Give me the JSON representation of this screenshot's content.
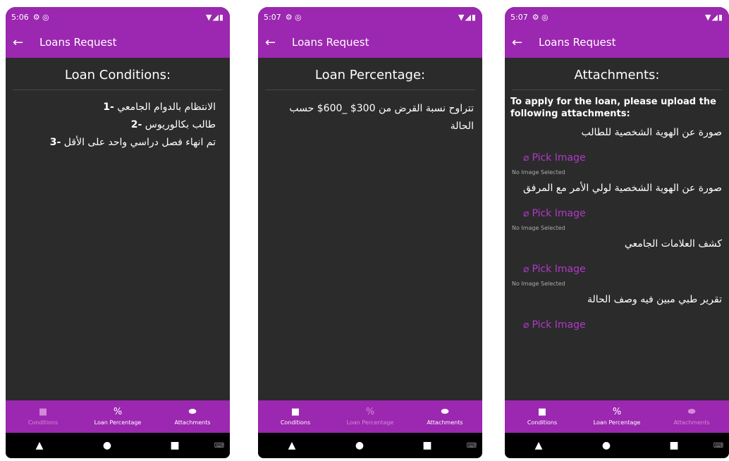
{
  "screens": [
    {
      "status_time": "5:06",
      "status_icons": "⚙ ◎",
      "status_right": "▼◢▮",
      "title": "Loans Request",
      "heading": "Loan Conditions:",
      "conditions": [
        {
          "num": "-1",
          "text": "الانتظام بالدوام الجامعي"
        },
        {
          "num": "-2",
          "text": "طالب بكالوريوس"
        },
        {
          "num": "-3",
          "text": "تم انهاء فصل دراسي واحد على الأقل"
        }
      ],
      "nav": [
        "Conditions",
        "Loan Percentage",
        "Attachments"
      ]
    },
    {
      "status_time": "5:07",
      "status_icons": "⚙ ◎",
      "status_right": "▼◢▮",
      "title": "Loans Request",
      "heading": "Loan Percentage:",
      "text": "تتراوح نسبة القرض من 300$ _600$ حسب الحالة",
      "nav": [
        "Conditions",
        "Loan Percentage",
        "Attachments"
      ]
    },
    {
      "status_time": "5:07",
      "status_icons": "⚙ ◎",
      "status_right": "▼◢▮",
      "title": "Loans Request",
      "heading": "Attachments:",
      "intro": "To apply for the loan, please upload the following attachments:",
      "attachments": [
        {
          "label": "صورة عن الهوية الشخصية للطالب",
          "pick": "Pick Image",
          "status": "No Image Selected"
        },
        {
          "label": "صورة عن الهوية الشخصية لولي الأمر مع المرفق",
          "pick": "Pick Image",
          "status": "No Image Selected"
        },
        {
          "label": "كشف العلامات الجامعي",
          "pick": "Pick Image",
          "status": "No Image Selected"
        },
        {
          "label": "تقرير طبي مبين فيه وصف الحالة",
          "pick": "Pick Image",
          "status": ""
        }
      ],
      "nav": [
        "Conditions",
        "Loan Percentage",
        "Attachments"
      ]
    }
  ],
  "colors": {
    "accent": "#9c27b0",
    "body": "#2b2b2b",
    "link": "#b239c8"
  },
  "icons": {
    "back": "arrow-left-icon",
    "conditions": "document-icon",
    "percentage": "percent-icon",
    "attachments": "toggle-icon",
    "clip": "paperclip-icon"
  }
}
